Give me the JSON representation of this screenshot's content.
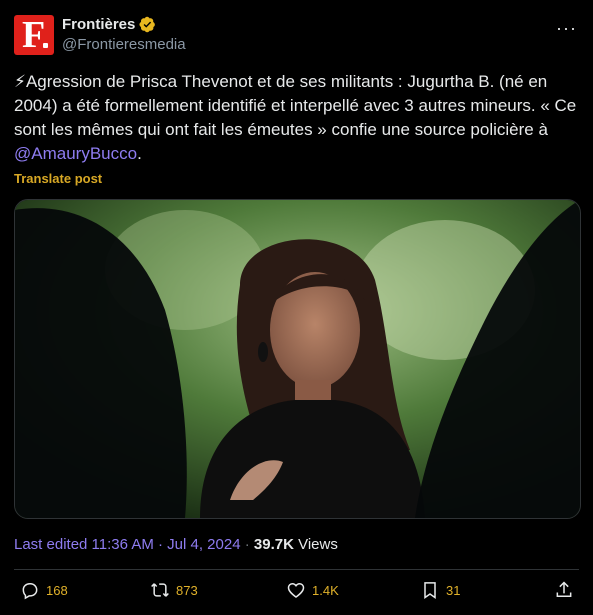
{
  "account": {
    "display_name": "Frontières",
    "handle": "@Frontieresmedia",
    "avatar_letter": "F"
  },
  "post": {
    "emoji": "⚡",
    "text_part1": "Agression de Prisca Thevenot et de ses militants : Jugurtha B. (né en 2004) a été formellement identifié et interpellé avec 3 autres mineurs. « Ce sont les mêmes qui ont fait les émeutes » confie une source policière à ",
    "mention": "@AmauryBucco",
    "text_end": "."
  },
  "translate_label": "Translate post",
  "meta": {
    "timestamp": "Last edited 11:36 AM · Jul 4, 2024",
    "separator": " · ",
    "views_count": "39.7K",
    "views_label": "Views"
  },
  "actions": {
    "replies": "168",
    "reposts": "873",
    "likes": "1.4K",
    "bookmarks": "31"
  },
  "colors": {
    "accent_link": "#8e7cf0",
    "action_count": "#e0b12a",
    "verified": "#e8b71f"
  }
}
